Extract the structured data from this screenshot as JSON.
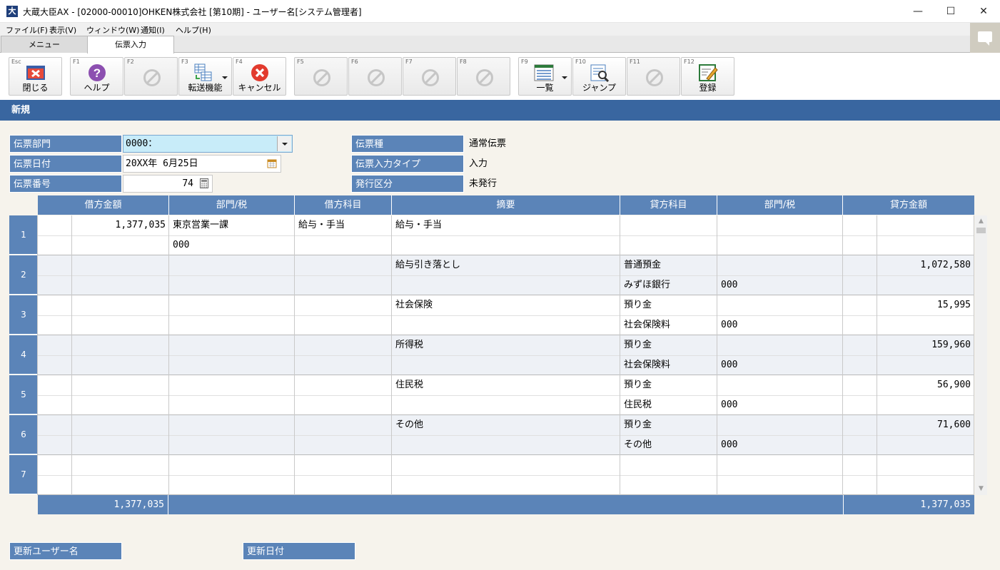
{
  "window": {
    "app_icon_char": "大",
    "title": "大蔵大臣AX - [02000-00010]OHKEN株式会社 [第10期] - ユーザー名[システム管理者]",
    "minimize_glyph": "—",
    "maximize_glyph": "☐",
    "close_glyph": "✕"
  },
  "menubar": {
    "items": [
      "ファイル(F)",
      "表示(V)",
      "ウィンドウ(W)",
      "通知(I)",
      "ヘルプ(H)"
    ]
  },
  "tabs": [
    {
      "label": "メニュー",
      "active": false
    },
    {
      "label": "伝票入力",
      "active": true
    }
  ],
  "toolbar": {
    "buttons": [
      {
        "key": "Esc",
        "label": "閉じる",
        "icon": "close-window-icon",
        "enabled": true
      },
      {
        "key": "F1",
        "label": "ヘルプ",
        "icon": "help-icon",
        "enabled": true
      },
      {
        "key": "F2",
        "label": "",
        "icon": "disabled-icon",
        "enabled": false
      },
      {
        "key": "F3",
        "label": "転送機能",
        "icon": "transfer-icon",
        "enabled": true
      },
      {
        "key": "F4",
        "label": "キャンセル",
        "icon": "cancel-icon",
        "enabled": true
      },
      {
        "key": "F5",
        "label": "",
        "icon": "disabled-icon",
        "enabled": false
      },
      {
        "key": "F6",
        "label": "",
        "icon": "disabled-icon",
        "enabled": false
      },
      {
        "key": "F7",
        "label": "",
        "icon": "disabled-icon",
        "enabled": false
      },
      {
        "key": "F8",
        "label": "",
        "icon": "disabled-icon",
        "enabled": false
      },
      {
        "key": "F9",
        "label": "一覧",
        "icon": "list-icon",
        "enabled": true
      },
      {
        "key": "F10",
        "label": "ジャンプ",
        "icon": "jump-icon",
        "enabled": true
      },
      {
        "key": "F11",
        "label": "",
        "icon": "disabled-icon",
        "enabled": false
      },
      {
        "key": "F12",
        "label": "登録",
        "icon": "register-icon",
        "enabled": true
      }
    ]
  },
  "mode_title": "新規",
  "header_fields": {
    "dept_label": "伝票部門",
    "dept_value": "0000：",
    "date_label": "伝票日付",
    "date_value": "20XX年 6月25日",
    "number_label": "伝票番号",
    "number_value": "74",
    "type_label": "伝票種",
    "type_value": "通常伝票",
    "input_type_label": "伝票入力タイプ",
    "input_type_value": "入力",
    "issue_label": "発行区分",
    "issue_value": "未発行"
  },
  "grid": {
    "columns": [
      "借方金額",
      "部門/税",
      "借方科目",
      "摘要",
      "貸方科目",
      "部門/税",
      "貸方金額"
    ],
    "rows": [
      {
        "no": "1",
        "debit_amount": "1,377,035",
        "debit_dept": "東京営業一課",
        "debit_tax": "000",
        "debit_account": "給与・手当",
        "summary": "給与・手当",
        "credit_account": "",
        "credit_sub": "",
        "credit_dept": "",
        "credit_tax": "",
        "credit_amount": ""
      },
      {
        "no": "2",
        "debit_amount": "",
        "debit_dept": "",
        "debit_tax": "",
        "debit_account": "",
        "summary": "給与引き落とし",
        "credit_account": "普通預金",
        "credit_sub": "みずほ銀行",
        "credit_dept": "",
        "credit_tax": "000",
        "credit_amount": "1,072,580"
      },
      {
        "no": "3",
        "debit_amount": "",
        "debit_dept": "",
        "debit_tax": "",
        "debit_account": "",
        "summary": "社会保険",
        "credit_account": "預り金",
        "credit_sub": "社会保険料",
        "credit_dept": "",
        "credit_tax": "000",
        "credit_amount": "15,995"
      },
      {
        "no": "4",
        "debit_amount": "",
        "debit_dept": "",
        "debit_tax": "",
        "debit_account": "",
        "summary": "所得税",
        "credit_account": "預り金",
        "credit_sub": "社会保険料",
        "credit_dept": "",
        "credit_tax": "000",
        "credit_amount": "159,960"
      },
      {
        "no": "5",
        "debit_amount": "",
        "debit_dept": "",
        "debit_tax": "",
        "debit_account": "",
        "summary": "住民税",
        "credit_account": "預り金",
        "credit_sub": "住民税",
        "credit_dept": "",
        "credit_tax": "000",
        "credit_amount": "56,900"
      },
      {
        "no": "6",
        "debit_amount": "",
        "debit_dept": "",
        "debit_tax": "",
        "debit_account": "",
        "summary": "その他",
        "credit_account": "預り金",
        "credit_sub": "その他",
        "credit_dept": "",
        "credit_tax": "000",
        "credit_amount": "71,600"
      },
      {
        "no": "7",
        "debit_amount": "",
        "debit_dept": "",
        "debit_tax": "",
        "debit_account": "",
        "summary": "",
        "credit_account": "",
        "credit_sub": "",
        "credit_dept": "",
        "credit_tax": "",
        "credit_amount": ""
      }
    ],
    "debit_total": "1,377,035",
    "credit_total": "1,377,035"
  },
  "footer": {
    "updated_user_label": "更新ユーザー名",
    "updated_date_label": "更新日付"
  },
  "colors": {
    "header_blue": "#3966a0",
    "label_blue": "#5b84b8",
    "focus_field": "#c8ecf9",
    "content_bg": "#f6f3ec"
  }
}
